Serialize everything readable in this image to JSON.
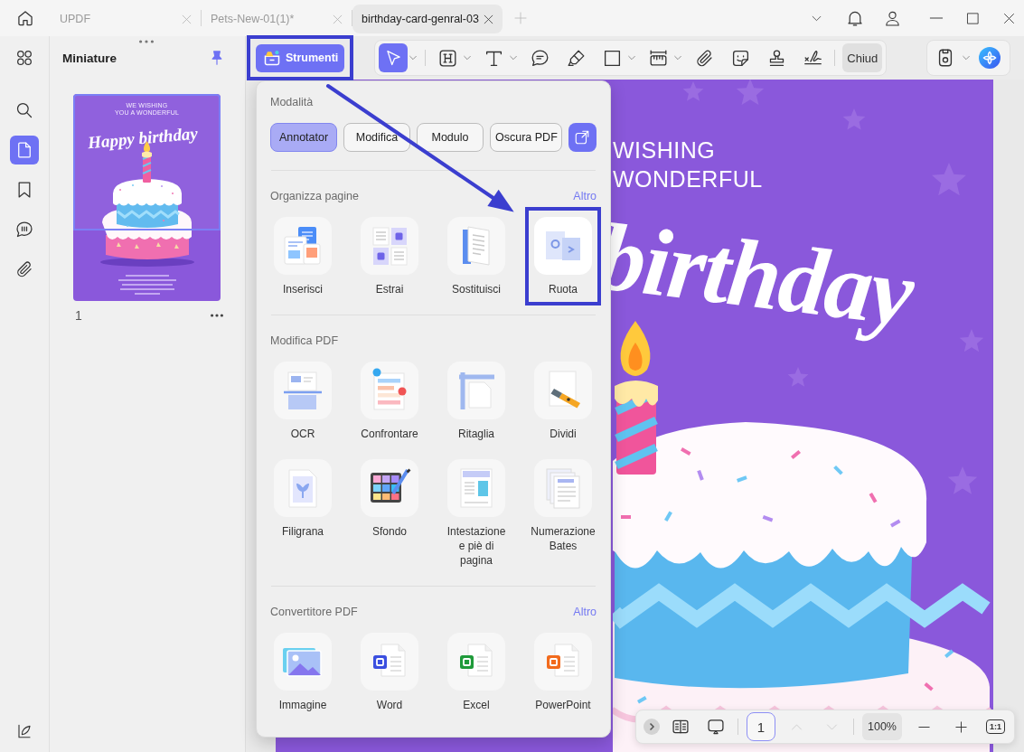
{
  "title_bar": {
    "tabs": [
      {
        "title": "UPDF",
        "selected": false
      },
      {
        "title": "Pets-New-01(1)*",
        "selected": false
      },
      {
        "title": "birthday-card-genral-03",
        "selected": true
      }
    ]
  },
  "left_rail": {
    "items": [
      {
        "kind": "apps",
        "selected": false
      },
      {
        "kind": "search",
        "selected": false
      },
      {
        "kind": "pages",
        "selected": true
      },
      {
        "kind": "bookmarks",
        "selected": false
      },
      {
        "kind": "comments",
        "selected": false
      },
      {
        "kind": "attachments",
        "selected": false
      }
    ]
  },
  "thumbnail_panel": {
    "title": "Miniature",
    "pinned": true,
    "pages": [
      {
        "number": "1",
        "card_lines": [
          "WE WISHING",
          "YOU A WONDERFUL"
        ],
        "card_headline": "Happy birthday"
      }
    ]
  },
  "toolbar": {
    "tools_button": {
      "label": "Strumenti",
      "highlighted": true
    },
    "tools": [
      {
        "kind": "select",
        "selected": true,
        "dropdown": true
      },
      {
        "kind": "heading",
        "selected": false,
        "dropdown": true
      },
      {
        "kind": "text",
        "selected": false,
        "dropdown": true
      },
      {
        "kind": "comment",
        "selected": false,
        "dropdown": false
      },
      {
        "kind": "highlighter",
        "selected": false,
        "dropdown": false
      },
      {
        "kind": "shape",
        "selected": false,
        "dropdown": true
      },
      {
        "kind": "measure",
        "selected": false,
        "dropdown": true
      },
      {
        "kind": "attachment",
        "selected": false,
        "dropdown": false
      },
      {
        "kind": "sticker",
        "selected": false,
        "dropdown": false
      },
      {
        "kind": "stamp",
        "selected": false,
        "dropdown": false
      },
      {
        "kind": "signature",
        "selected": false,
        "dropdown": false
      }
    ],
    "close_button": "Chiud"
  },
  "tools_menu": {
    "sections": [
      {
        "title": "Modalità",
        "kind": "modes",
        "items": [
          {
            "label": "Annotator",
            "selected": true
          },
          {
            "label": "Modifica",
            "selected": false
          },
          {
            "label": "Modulo",
            "selected": false
          },
          {
            "label": "Oscura PDF",
            "selected": false
          }
        ]
      },
      {
        "title": "Organizza pagine",
        "more": "Altro",
        "kind": "tiles",
        "items": [
          {
            "label": "Inserisci",
            "kind": "insert",
            "highlighted": false
          },
          {
            "label": "Estrai",
            "kind": "extract",
            "highlighted": false
          },
          {
            "label": "Sostituisci",
            "kind": "replace",
            "highlighted": false
          },
          {
            "label": "Ruota",
            "kind": "rotate",
            "highlighted": true
          }
        ]
      },
      {
        "title": "Modifica PDF",
        "kind": "tiles",
        "items": [
          {
            "label": "OCR",
            "kind": "ocr",
            "highlighted": false
          },
          {
            "label": "Confrontare",
            "kind": "compare",
            "highlighted": false
          },
          {
            "label": "Ritaglia",
            "kind": "crop",
            "highlighted": false
          },
          {
            "label": "Dividi",
            "kind": "split",
            "highlighted": false
          },
          {
            "label": "Filigrana",
            "kind": "watermark",
            "highlighted": false
          },
          {
            "label": "Sfondo",
            "kind": "background",
            "highlighted": false
          },
          {
            "label": "Intestazione e piè di pagina",
            "kind": "header_footer",
            "highlighted": false
          },
          {
            "label": "Numerazione Bates",
            "kind": "bates",
            "highlighted": false
          }
        ]
      },
      {
        "title": "Convertitore PDF",
        "more": "Altro",
        "kind": "tiles",
        "items": [
          {
            "label": "Immagine",
            "kind": "image",
            "highlighted": false
          },
          {
            "label": "Word",
            "kind": "word",
            "highlighted": false
          },
          {
            "label": "Excel",
            "kind": "excel",
            "highlighted": false
          },
          {
            "label": "PowerPoint",
            "kind": "powerpoint",
            "highlighted": false
          }
        ]
      }
    ]
  },
  "document": {
    "lines": [
      "WISHING",
      "WONDERFUL"
    ],
    "headline": "birthday"
  },
  "page_nav": {
    "page": "1",
    "nav": [
      {
        "kind": "previous",
        "disabled": true
      },
      {
        "kind": "next",
        "disabled": true
      }
    ],
    "zoom": "100%",
    "actual_size": "1:1"
  }
}
